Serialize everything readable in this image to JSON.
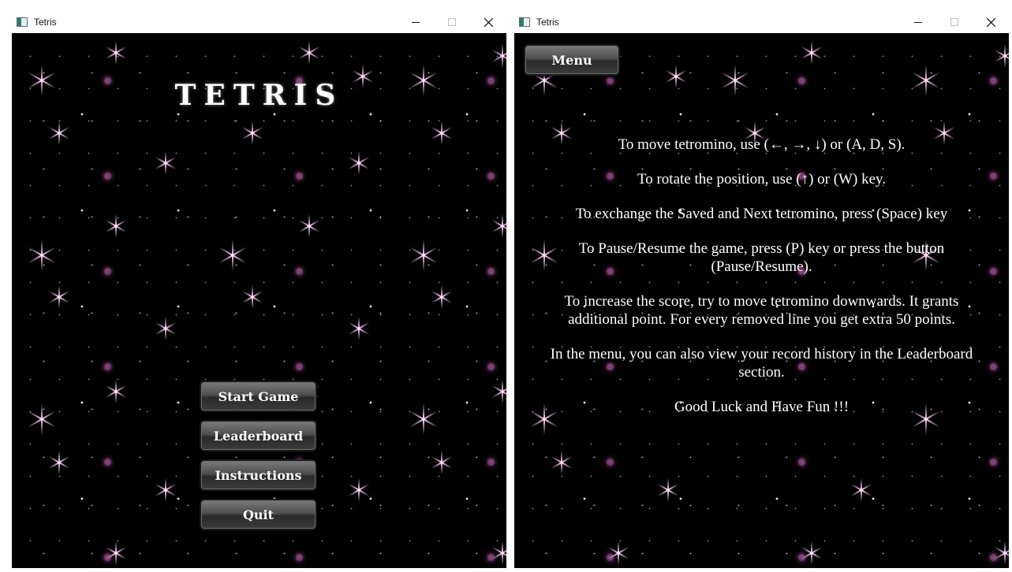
{
  "windows": [
    {
      "title": "Tetris",
      "game_title": "TETRIS",
      "menu": [
        "Start Game",
        "Leaderboard",
        "Instructions",
        "Quit"
      ]
    },
    {
      "title": "Tetris",
      "menu_button": "Menu",
      "instructions": [
        "To move tetromino, use (←, →, ↓) or (A, D, S).",
        "To rotate the position, use (↑) or (W) key.",
        "To exchange the Saved and Next tetromino, press (Space) key",
        "To Pause/Resume the game, press (P) key or press the button (Pause/Resume).",
        "To increase the score, try to move tetromino downwards. It grants additional point. For every removed line you get extra 50 points.",
        "In the menu, you can also view your record history in the Leaderboard section.",
        "Good Luck and Have Fun !!!"
      ]
    }
  ],
  "icons": {
    "minimize": "minimize-icon",
    "maximize": "maximize-icon",
    "close": "close-icon",
    "app": "tetris-app-icon",
    "sparkle": "pink-star-sparkle"
  },
  "colors": {
    "background": "#000000",
    "text": "#ffffff",
    "button": "#4e4e4e",
    "sparkle": "#f4c6ee"
  }
}
